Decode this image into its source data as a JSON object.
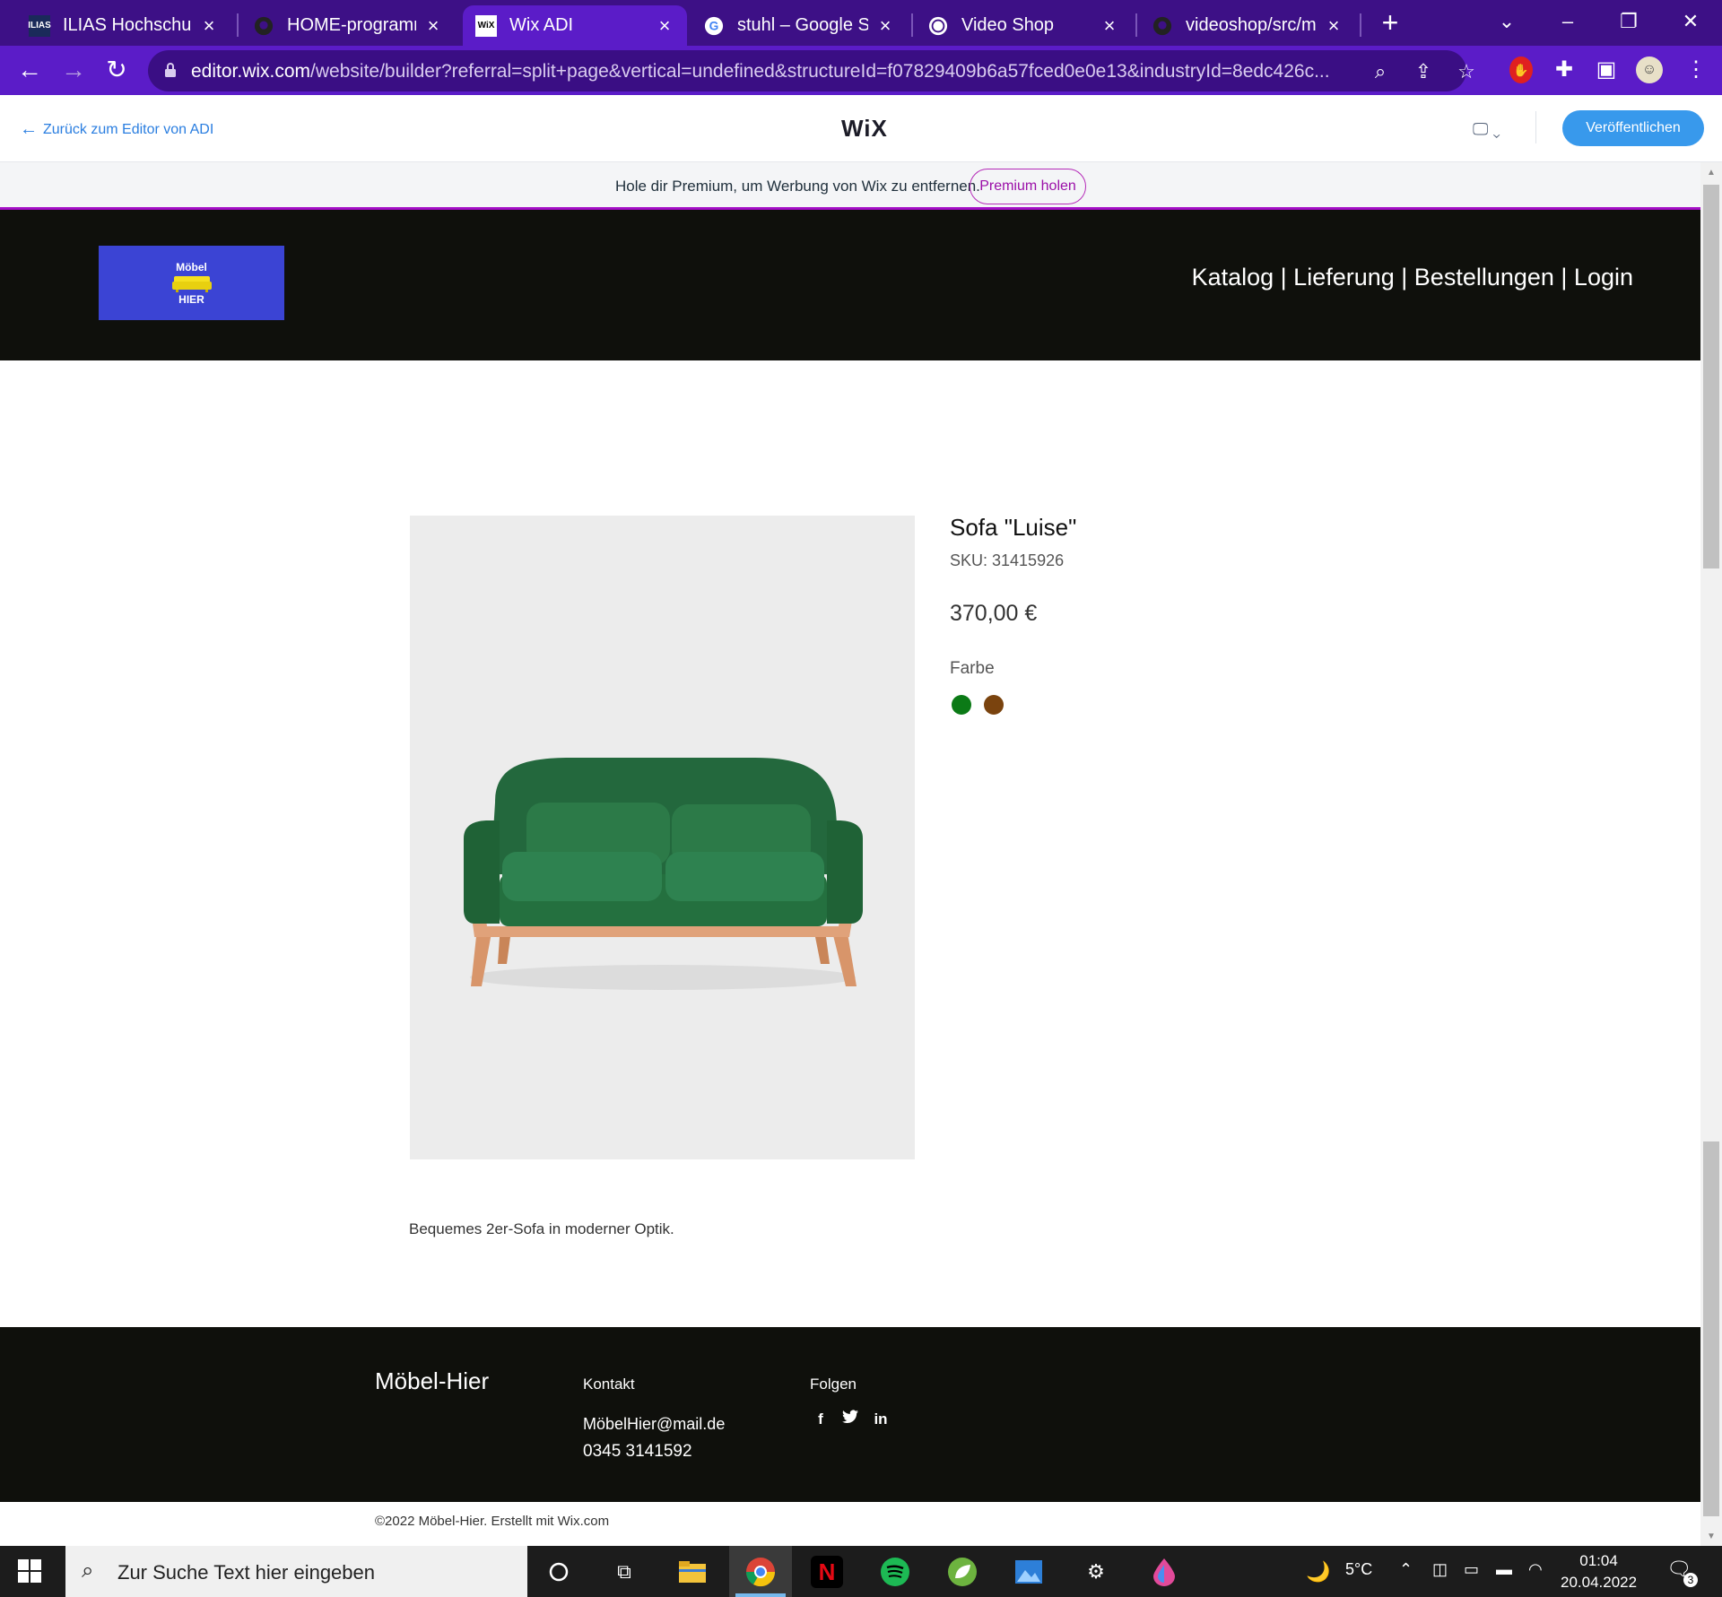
{
  "browser": {
    "tabs": [
      {
        "title": "ILIAS Hochschule M",
        "favicon": "ILIAS",
        "active": false
      },
      {
        "title": "HOME-programmir",
        "favicon": "github-icon",
        "active": false
      },
      {
        "title": "Wix ADI",
        "favicon": "WiX",
        "active": true
      },
      {
        "title": "stuhl – Google Suc",
        "favicon": "google-icon",
        "active": false
      },
      {
        "title": "Video Shop",
        "favicon": "globe-icon",
        "active": false
      },
      {
        "title": "videoshop/src/mair",
        "favicon": "github-icon",
        "active": false
      }
    ],
    "url_domain": "editor.wix.com",
    "url_path": "/website/builder?referral=split+page&vertical=undefined&structureId=f07829409b6a57fced0e0e13&industryId=8edc426c..."
  },
  "wix_editor": {
    "back_link": "Zurück zum Editor von ADI",
    "logo": "WiX",
    "publish_button": "Veröffentlichen"
  },
  "premium_banner": {
    "text": "Hole dir Premium, um Werbung von Wix zu entfernen.",
    "button": "Premium holen"
  },
  "site": {
    "logo_line1": "Möbel",
    "logo_line2": "HIER",
    "nav": "Katalog | Lieferung | Bestellungen | Login",
    "product": {
      "name": "Sofa \"Luise\"",
      "sku": "SKU: 31415926",
      "price": "370,00 €",
      "color_label": "Farbe",
      "colors": [
        "#0b7a16",
        "#7a430e"
      ],
      "description": "Bequemes 2er-Sofa in moderner Optik."
    },
    "footer": {
      "brand": "Möbel-Hier",
      "contact_heading": "Kontakt",
      "email": "MöbelHier@mail.de",
      "phone": "0345 3141592",
      "follow_heading": "Folgen",
      "social": [
        "f",
        "t",
        "in"
      ]
    },
    "copyright": "©2022 Möbel-Hier. Erstellt mit Wix.com"
  },
  "taskbar": {
    "search_placeholder": "Zur Suche Text hier eingeben",
    "weather": "5°C",
    "time": "01:04",
    "date": "20.04.2022",
    "notification_count": "3"
  }
}
